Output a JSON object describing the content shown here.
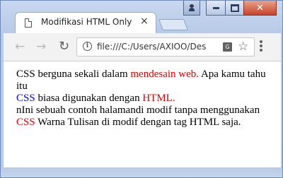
{
  "window": {
    "controls": {
      "user": "user",
      "minimize": "minimize",
      "maximize": "maximize",
      "close": "close"
    }
  },
  "tab": {
    "title": "Modifikasi HTML Only",
    "close": "×",
    "icon": "document-icon"
  },
  "toolbar": {
    "back": "←",
    "forward": "→",
    "reload": "↻",
    "url": "file:///C:/Users/AXIOO/Des",
    "info_icon": "i",
    "translate_icon": "G",
    "star_icon": "☆"
  },
  "content": {
    "line1_a": "CSS berguna sekali dalam ",
    "line1_b": "mendesain web.",
    "line1_c": " Apa kamu tahu itu",
    "line2_a": "CSS",
    "line2_b": " biasa digunakan dengan ",
    "line2_c": "HTML.",
    "line3": "nIni sebuah contoh halamandi modif tanpa menggunakan ",
    "line3_b": "CSS",
    "line3_c": " Warna Tulisan di modif dengan tag HTML saja."
  },
  "colors": {
    "red_text": "#e00000",
    "blue_text": "#0000ff",
    "frame": "#b9cbe6"
  }
}
